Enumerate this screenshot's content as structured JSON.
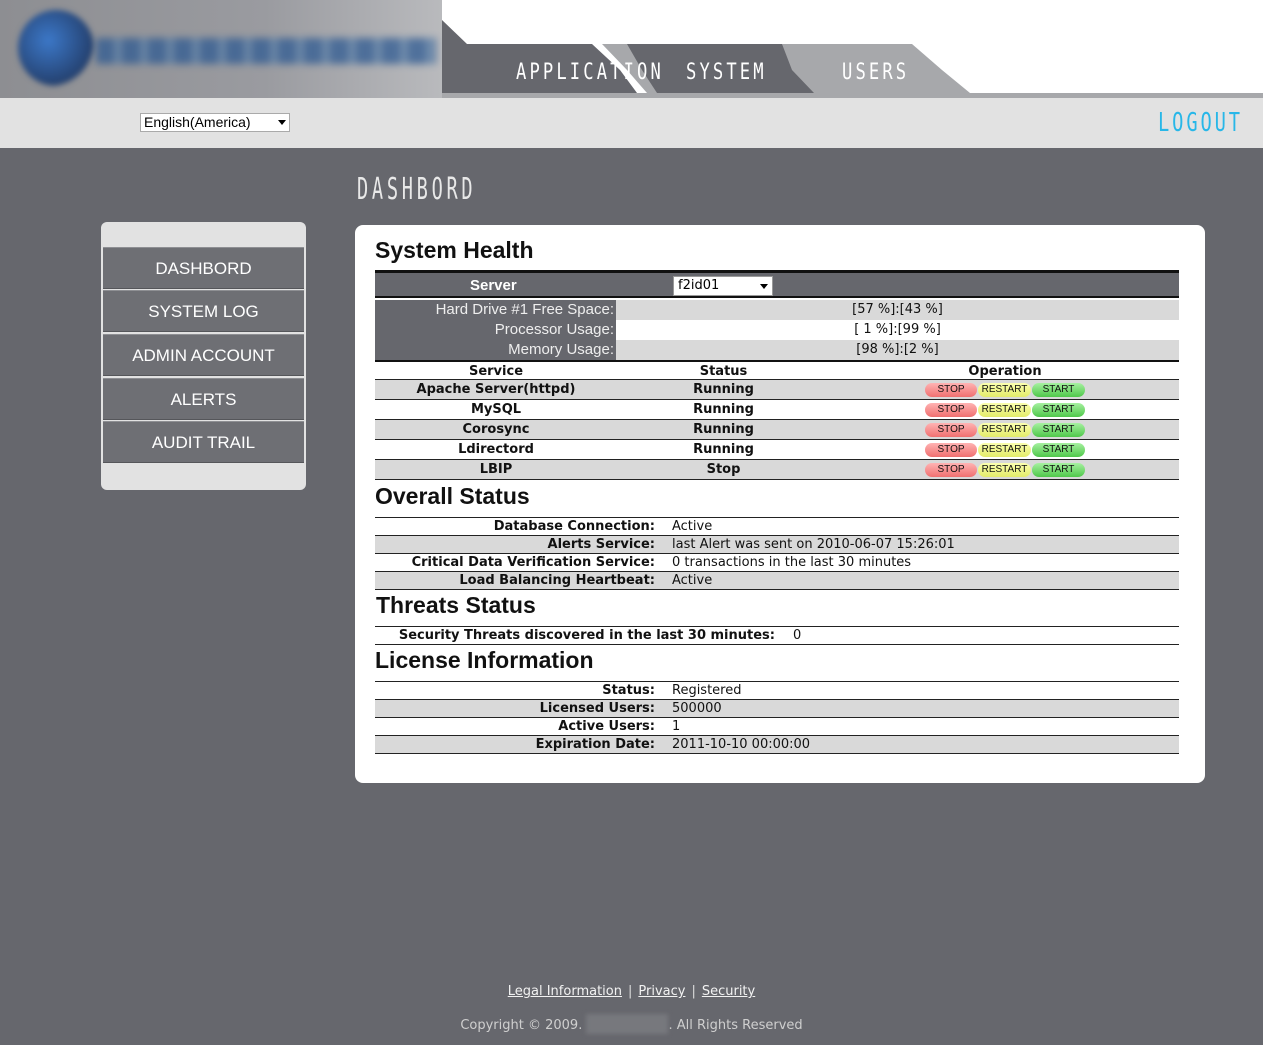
{
  "nav": {
    "tabs": [
      {
        "label": "APPLICATION"
      },
      {
        "label": "SYSTEM"
      },
      {
        "label": "USERS"
      }
    ],
    "active_tab": "SYSTEM"
  },
  "language": {
    "selected": "English(America)"
  },
  "logout_label": "LOGOUT",
  "page_title": "DASHBORD",
  "sidebar": {
    "items": [
      {
        "label": "DASHBORD"
      },
      {
        "label": "SYSTEM LOG"
      },
      {
        "label": "ADMIN ACCOUNT"
      },
      {
        "label": "ALERTS"
      },
      {
        "label": "AUDIT TRAIL"
      }
    ]
  },
  "system_health": {
    "title": "System Health",
    "server_label": "Server",
    "server_selected": "f2id01",
    "usage": [
      {
        "label": "Hard Drive #1 Free Space:",
        "value": "[57 %]:[43 %]"
      },
      {
        "label": "Processor Usage:",
        "value": "[ 1 %]:[99 %]"
      },
      {
        "label": "Memory Usage:",
        "value": "[98 %]:[2 %]"
      }
    ],
    "columns": {
      "service": "Service",
      "status": "Status",
      "operation": "Operation"
    },
    "buttons": {
      "stop": "STOP",
      "restart": "RESTART",
      "start": "START"
    },
    "services": [
      {
        "name": "Apache Server(httpd)",
        "status": "Running"
      },
      {
        "name": "MySQL",
        "status": "Running"
      },
      {
        "name": "Corosync",
        "status": "Running"
      },
      {
        "name": "Ldirectord",
        "status": "Running"
      },
      {
        "name": "LBIP",
        "status": "Stop"
      }
    ]
  },
  "overall_status": {
    "title": "Overall Status",
    "rows": [
      {
        "key": "Database Connection:",
        "value": "Active"
      },
      {
        "key": "Alerts Service:",
        "value": "last Alert was sent on 2010-06-07 15:26:01"
      },
      {
        "key": "Critical Data Verification Service:",
        "value": "0 transactions in the last 30 minutes"
      },
      {
        "key": "Load Balancing Heartbeat:",
        "value": "Active"
      }
    ]
  },
  "threats_status": {
    "title": "Threats Status",
    "key": "Security Threats discovered in the last 30 minutes:",
    "value": "0"
  },
  "license": {
    "title": "License Information",
    "rows": [
      {
        "key": "Status:",
        "value": "Registered"
      },
      {
        "key": "Licensed Users:",
        "value": "500000"
      },
      {
        "key": "Active Users:",
        "value": "1"
      },
      {
        "key": "Expiration Date:",
        "value": "2011-10-10 00:00:00"
      }
    ]
  },
  "footer": {
    "links": [
      {
        "label": "Legal Information"
      },
      {
        "label": "Privacy"
      },
      {
        "label": "Security"
      }
    ],
    "separator": "|",
    "copyright_prefix": "Copyright © 2009.",
    "copyright_suffix": ". All Rights Reserved"
  },
  "colors": {
    "background": "#66676d",
    "accent": "#28b7e8",
    "stop_button": "#f07070",
    "restart_button": "#e3ec6a",
    "start_button": "#4fc84a"
  }
}
